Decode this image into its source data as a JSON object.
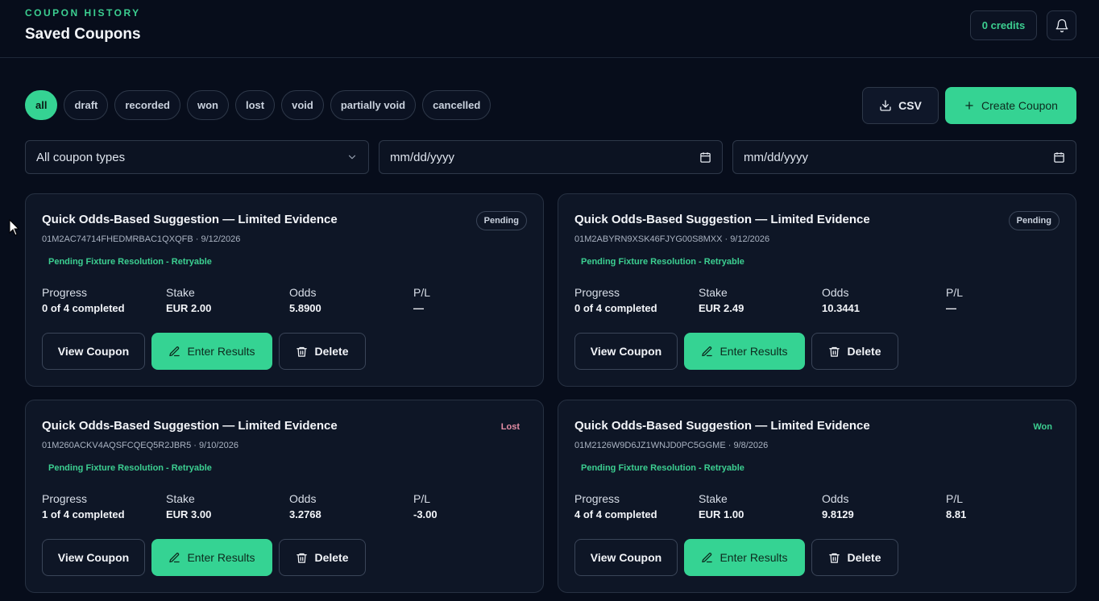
{
  "header": {
    "eyebrow": "COUPON HISTORY",
    "title": "Saved Coupons",
    "credits": "0 credits"
  },
  "filters": [
    "all",
    "draft",
    "recorded",
    "won",
    "lost",
    "void",
    "partially void",
    "cancelled"
  ],
  "active_filter": "all",
  "actions": {
    "csv": "CSV",
    "create": "Create Coupon"
  },
  "inputs": {
    "coupon_type": "All coupon types",
    "date_from_placeholder": "mm/dd/yyyy",
    "date_to_placeholder": "mm/dd/yyyy"
  },
  "stat_labels": {
    "progress": "Progress",
    "stake": "Stake",
    "odds": "Odds",
    "pl": "P/L"
  },
  "button_labels": {
    "view": "View Coupon",
    "enter": "Enter Results",
    "delete": "Delete"
  },
  "coupons": [
    {
      "title": "Quick Odds-Based Suggestion — Limited Evidence",
      "id_line": "01M2AC74714FHEDMRBAC1QXQFB · 9/12/2026",
      "note": "Pending Fixture Resolution - Retryable",
      "status": "Pending",
      "progress": "0 of 4 completed",
      "stake": "EUR 2.00",
      "odds": "5.8900",
      "pl": "—"
    },
    {
      "title": "Quick Odds-Based Suggestion — Limited Evidence",
      "id_line": "01M2ABYRN9XSK46FJYG00S8MXX · 9/12/2026",
      "note": "Pending Fixture Resolution - Retryable",
      "status": "Pending",
      "progress": "0 of 4 completed",
      "stake": "EUR 2.49",
      "odds": "10.3441",
      "pl": "—"
    },
    {
      "title": "Quick Odds-Based Suggestion — Limited Evidence",
      "id_line": "01M260ACKV4AQSFCQEQ5R2JBR5 · 9/10/2026",
      "note": "Pending Fixture Resolution - Retryable",
      "status": "Lost",
      "progress": "1 of 4 completed",
      "stake": "EUR 3.00",
      "odds": "3.2768",
      "pl": "-3.00"
    },
    {
      "title": "Quick Odds-Based Suggestion — Limited Evidence",
      "id_line": "01M2126W9D6JZ1WNJD0PC5GGME · 9/8/2026",
      "note": "Pending Fixture Resolution - Retryable",
      "status": "Won",
      "progress": "4 of 4 completed",
      "stake": "EUR 1.00",
      "odds": "9.8129",
      "pl": "8.81"
    }
  ],
  "colors": {
    "accent": "#35d393",
    "lost": "#e58ea5",
    "background": "#070d1b"
  }
}
